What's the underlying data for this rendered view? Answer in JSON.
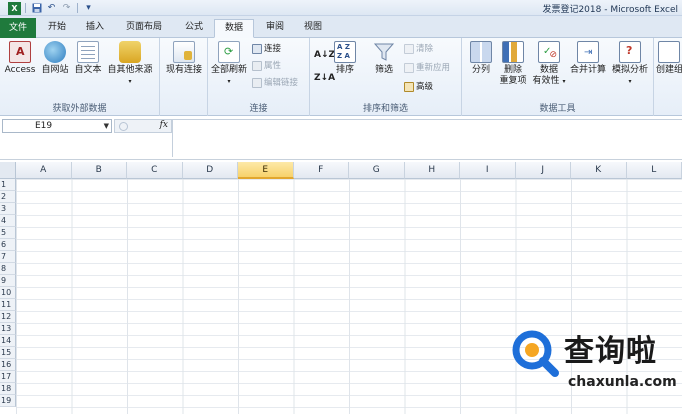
{
  "window": {
    "title": "发票登记2018 - Microsoft Excel"
  },
  "qat": {
    "icons": [
      "save-icon",
      "undo-icon",
      "redo-icon",
      "customize-icon"
    ]
  },
  "tabs": [
    {
      "label": "文件",
      "id": "file"
    },
    {
      "label": "开始",
      "id": "home"
    },
    {
      "label": "插入",
      "id": "insert"
    },
    {
      "label": "页面布局",
      "id": "page-layout"
    },
    {
      "label": "公式",
      "id": "formulas"
    },
    {
      "label": "数据",
      "id": "data",
      "active": true
    },
    {
      "label": "审阅",
      "id": "review"
    },
    {
      "label": "视图",
      "id": "view"
    }
  ],
  "ribbon": {
    "get_external": {
      "label": "获取外部数据",
      "access": "Access",
      "web": "自网站",
      "text": "自文本",
      "other": "自其他来源"
    },
    "existing": {
      "label": "现有连接"
    },
    "connections": {
      "label": "连接",
      "refresh_all": "全部刷新",
      "connections": "连接",
      "properties": "属性",
      "edit_links": "编辑链接"
    },
    "sort_filter": {
      "label": "排序和筛选",
      "sort": "排序",
      "filter": "筛选",
      "clear": "清除",
      "reapply": "重新应用",
      "advanced": "高级"
    },
    "data_tools": {
      "label": "数据工具",
      "text_to_columns": "分列",
      "remove_dup_1": "删除",
      "remove_dup_2": "重复项",
      "validation_1": "数据",
      "validation_2": "有效性",
      "consolidate": "合并计算",
      "what_if": "模拟分析"
    },
    "outline": {
      "group": "创建组"
    }
  },
  "formula_bar": {
    "name_box": "E19",
    "fx": "fx",
    "formula": ""
  },
  "grid": {
    "columns": [
      "A",
      "B",
      "C",
      "D",
      "E",
      "F",
      "G",
      "H",
      "I",
      "J",
      "K",
      "L"
    ],
    "selected_column": "E",
    "rows": [
      "1",
      "2",
      "3",
      "4",
      "5",
      "6",
      "7",
      "8",
      "9",
      "10",
      "11",
      "12",
      "13",
      "14",
      "15",
      "16",
      "17",
      "18",
      "19"
    ]
  },
  "watermark": {
    "cn": "查询啦",
    "en": "chaxunla.com"
  },
  "colors": {
    "file_tab": "#1f7a3c",
    "selected_header": "#f7d26b",
    "watermark_blue": "#1e6fd9"
  }
}
